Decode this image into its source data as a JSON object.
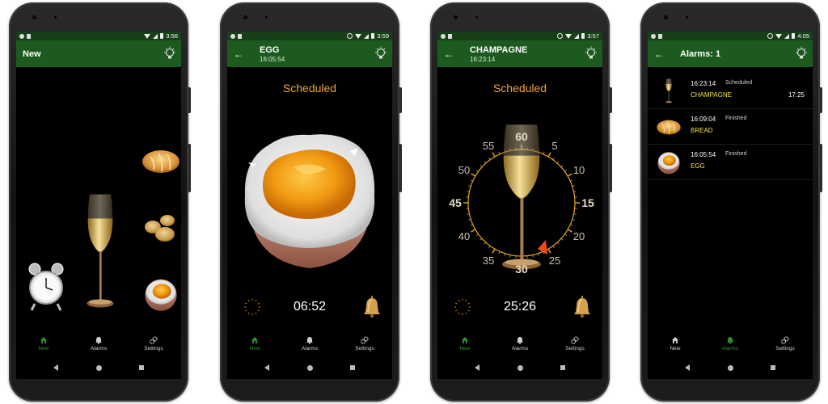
{
  "colors": {
    "appbar": "#1d5a1f",
    "statusbar": "#173f18",
    "accent_orange": "#f3a531",
    "nav_active": "#2f8b33",
    "item_yellow": "#f2e04d"
  },
  "nav": {
    "new": "New",
    "alarms": "Alarms",
    "settings": "Settings"
  },
  "screens": [
    {
      "status_time": "3:56",
      "title": "New",
      "subtitle": ""
    },
    {
      "status_time": "3:59",
      "title": "EGG",
      "subtitle": "16:05:54",
      "state": "Scheduled",
      "countdown": "06:52"
    },
    {
      "status_time": "3:57",
      "title": "CHAMPAGNE",
      "subtitle": "16:23:14",
      "state": "Scheduled",
      "countdown": "25:26",
      "dial": [
        "60",
        "5",
        "10",
        "15",
        "20",
        "25",
        "30",
        "35",
        "40",
        "45",
        "50",
        "55"
      ]
    },
    {
      "status_time": "4:05",
      "title": "Alarms: 1",
      "subtitle": "",
      "alarms": [
        {
          "time": "16:23:14",
          "state": "Scheduled",
          "name": "CHAMPAGNE",
          "due": "17:25",
          "icon": "champagne-glass-icon"
        },
        {
          "time": "16:09:04",
          "state": "Finished",
          "name": "BREAD",
          "due": "",
          "icon": "bread-icon"
        },
        {
          "time": "16:05:54",
          "state": "Finished",
          "name": "EGG",
          "due": "",
          "icon": "egg-icon"
        }
      ]
    }
  ]
}
